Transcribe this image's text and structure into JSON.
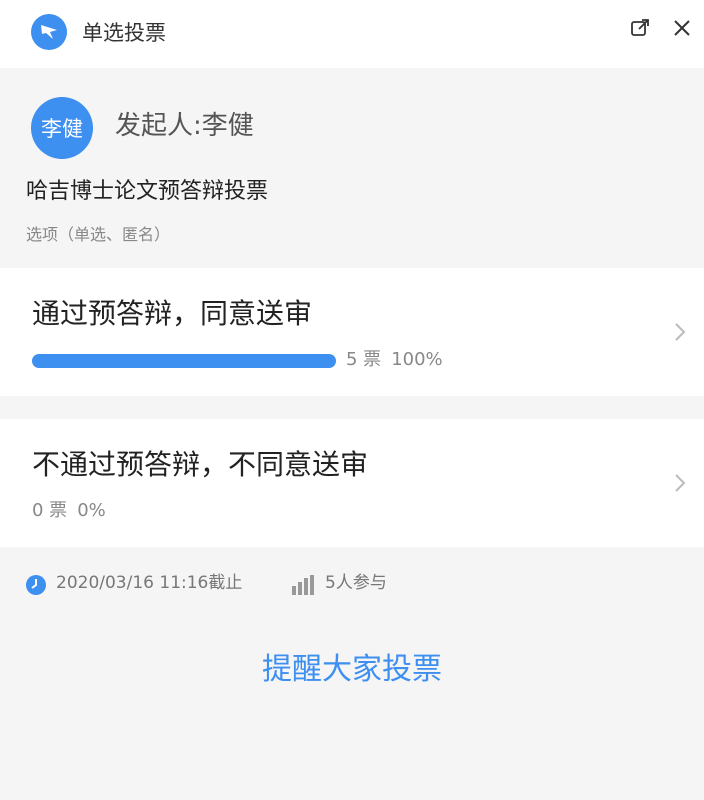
{
  "window": {
    "title": "单选投票"
  },
  "header": {
    "avatar_text": "李健",
    "initiator": "发起人:李健",
    "vote_title": "哈吉博士论文预答辩投票",
    "vote_subtitle": "选项（单选、匿名）"
  },
  "options": [
    {
      "label": "通过预答辩，同意送审",
      "votes": "5 票",
      "percent": "100%",
      "fill_fraction": 1.0
    },
    {
      "label": "不通过预答辩，不同意送审",
      "votes": "0 票",
      "percent": "0%",
      "fill_fraction": 0
    }
  ],
  "footer": {
    "deadline": "2020/03/16 11:16截止",
    "participants": "5人参与",
    "remind_button": "提醒大家投票"
  },
  "colors": {
    "accent": "#3d8ff0",
    "panel_bg": "#f5f5f5",
    "card_bg": "#ffffff"
  },
  "icons": {
    "app": "app-logo-icon",
    "popout": "popout-icon",
    "close": "close-icon",
    "chevron": "chevron-right-icon",
    "clock": "clock-icon",
    "stats": "bar-chart-icon"
  }
}
